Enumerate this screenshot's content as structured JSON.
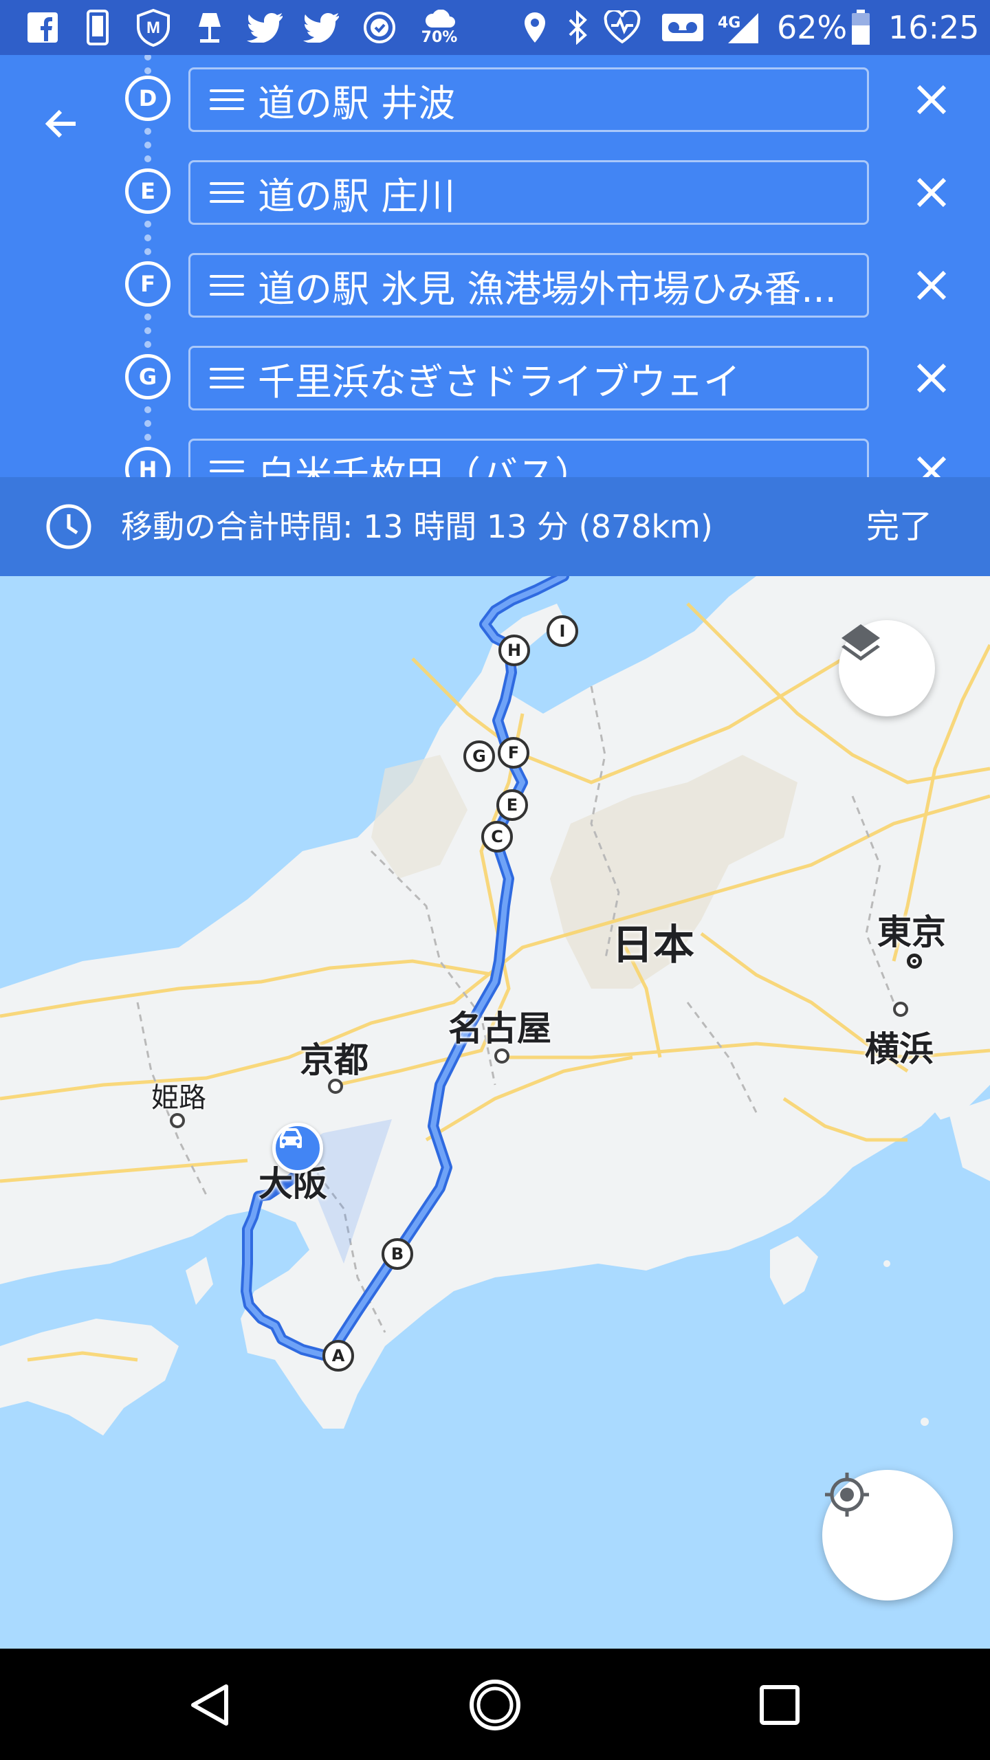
{
  "status_bar": {
    "network": "4G",
    "battery": "62%",
    "time": "16:25",
    "weather_percent": "70%",
    "icons": [
      "facebook-icon",
      "phone-icon",
      "shield-m-icon",
      "lamp-icon",
      "twitter-icon",
      "twitter-icon",
      "check-badge-icon",
      "weather-icon",
      "location-icon",
      "bluetooth-icon",
      "heart-rate-icon",
      "voicemail-icon",
      "signal-icon",
      "battery-icon"
    ]
  },
  "waypoints": [
    {
      "letter": "D",
      "name": "道の駅 井波"
    },
    {
      "letter": "E",
      "name": "道の駅 庄川"
    },
    {
      "letter": "F",
      "name": "道の駅 氷見 漁港場外市場ひみ番..."
    },
    {
      "letter": "G",
      "name": "千里浜なぎさドライブウェイ"
    },
    {
      "letter": "H",
      "name": "白米千枚田（バス）"
    }
  ],
  "summary": {
    "text": "移動の合計時間: 13 時間 13 分 (878km)",
    "done_label": "完了"
  },
  "map": {
    "labels": {
      "tokyo": "東京",
      "yokohama": "横浜",
      "nagoya": "名古屋",
      "kyoto": "京都",
      "osaka": "大阪",
      "himeji": "姫路",
      "japan": "日本"
    },
    "route_pins": [
      "A",
      "B",
      "C",
      "E",
      "F",
      "G",
      "H",
      "I"
    ],
    "colors": {
      "water": "#aadaff",
      "land": "#f1f3f4",
      "route": "#4285f4",
      "road": "#f9d56e"
    }
  }
}
